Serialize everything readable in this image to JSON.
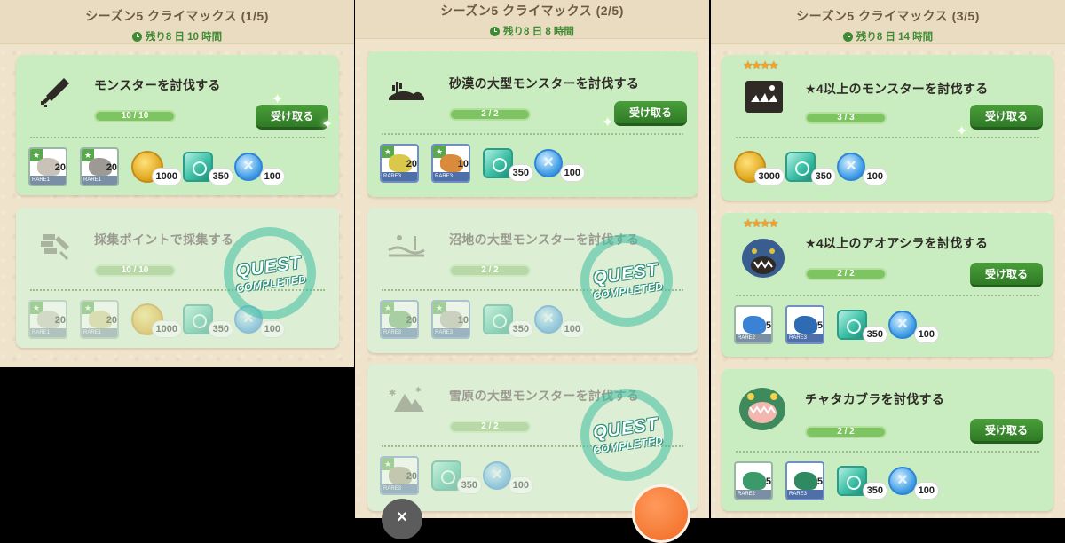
{
  "panels": [
    {
      "title": "シーズン5 クライマックス (1/5)",
      "time": "残り8 日 10 時間",
      "quests": [
        {
          "title": "モンスターを討伐する",
          "progress": "10 / 10",
          "claim": "受け取る",
          "completed": false,
          "icon": "sword-icon",
          "rewards": [
            {
              "type": "card",
              "rarity": "RARE1",
              "qty": "20"
            },
            {
              "type": "card",
              "rarity": "RARE1",
              "qty": "20"
            },
            {
              "type": "coin",
              "qty": "1000"
            },
            {
              "type": "gem",
              "qty": "350"
            },
            {
              "type": "orb",
              "qty": "100"
            }
          ]
        },
        {
          "title": "採集ポイントで採集する",
          "progress": "10 / 10",
          "completed": true,
          "icon": "gather-icon",
          "stamp": {
            "top": "QUEST",
            "bottom": "COMPLETED"
          },
          "rewards": [
            {
              "type": "card",
              "rarity": "RARE1",
              "qty": "20"
            },
            {
              "type": "card",
              "rarity": "RARE1",
              "qty": "20"
            },
            {
              "type": "coin",
              "qty": "1000"
            },
            {
              "type": "gem",
              "qty": "350"
            },
            {
              "type": "orb",
              "qty": "100"
            }
          ]
        }
      ]
    },
    {
      "title": "シーズン5 クライマックス (2/5)",
      "time": "残り8 日 8 時間",
      "quests": [
        {
          "title": "砂漠の大型モンスターを討伐する",
          "progress": "2 / 2",
          "claim": "受け取る",
          "completed": false,
          "icon": "desert-icon",
          "rewards": [
            {
              "type": "card",
              "rarity": "RARE3",
              "qty": "20"
            },
            {
              "type": "card",
              "rarity": "RARE3",
              "qty": "10"
            },
            {
              "type": "gem",
              "qty": "350"
            },
            {
              "type": "orb",
              "qty": "100"
            }
          ]
        },
        {
          "title": "沼地の大型モンスターを討伐する",
          "progress": "2 / 2",
          "completed": true,
          "icon": "swamp-icon",
          "stamp": {
            "top": "QUEST",
            "bottom": "COMPLETED"
          },
          "rewards": [
            {
              "type": "card",
              "rarity": "RARE3",
              "qty": "20"
            },
            {
              "type": "card",
              "rarity": "RARE3",
              "qty": "10"
            },
            {
              "type": "gem",
              "qty": "350"
            },
            {
              "type": "orb",
              "qty": "100"
            }
          ]
        },
        {
          "title": "雪原の大型モンスターを討伐する",
          "progress": "2 / 2",
          "completed": true,
          "icon": "snowfield-icon",
          "stamp": {
            "top": "QUEST",
            "bottom": "COMPLETED"
          },
          "rewards": [
            {
              "type": "card",
              "rarity": "RARE3",
              "qty": "20"
            },
            {
              "type": "gem",
              "qty": "350"
            },
            {
              "type": "orb",
              "qty": "100"
            }
          ]
        }
      ]
    },
    {
      "title": "シーズン5 クライマックス (3/5)",
      "time": "残り8 日 14 時間",
      "quests": [
        {
          "title": "★4以上のモンスターを討伐する",
          "progress": "3 / 3",
          "claim": "受け取る",
          "completed": false,
          "icon": "monster-fang-icon",
          "stars": "★★★★",
          "rewards": [
            {
              "type": "coin",
              "qty": "3000"
            },
            {
              "type": "gem",
              "qty": "350"
            },
            {
              "type": "orb",
              "qty": "100"
            }
          ]
        },
        {
          "title": "★4以上のアオアシラを討伐する",
          "progress": "2 / 2",
          "claim": "受け取る",
          "completed": false,
          "icon": "arzuros-icon",
          "stars": "★★★★",
          "rewards": [
            {
              "type": "card",
              "rarity": "RARE2",
              "qty": "5"
            },
            {
              "type": "card",
              "rarity": "RARE3",
              "qty": "5"
            },
            {
              "type": "gem",
              "qty": "350"
            },
            {
              "type": "orb",
              "qty": "100"
            }
          ]
        },
        {
          "title": "チャタカブラを討伐する",
          "progress": "2 / 2",
          "claim": "受け取る",
          "completed": false,
          "icon": "chatacabra-icon",
          "rewards": [
            {
              "type": "card",
              "rarity": "RARE2",
              "qty": "5"
            },
            {
              "type": "card",
              "rarity": "RARE3",
              "qty": "5"
            },
            {
              "type": "gem",
              "qty": "350"
            },
            {
              "type": "orb",
              "qty": "100"
            }
          ]
        }
      ]
    }
  ],
  "close_label": "×"
}
